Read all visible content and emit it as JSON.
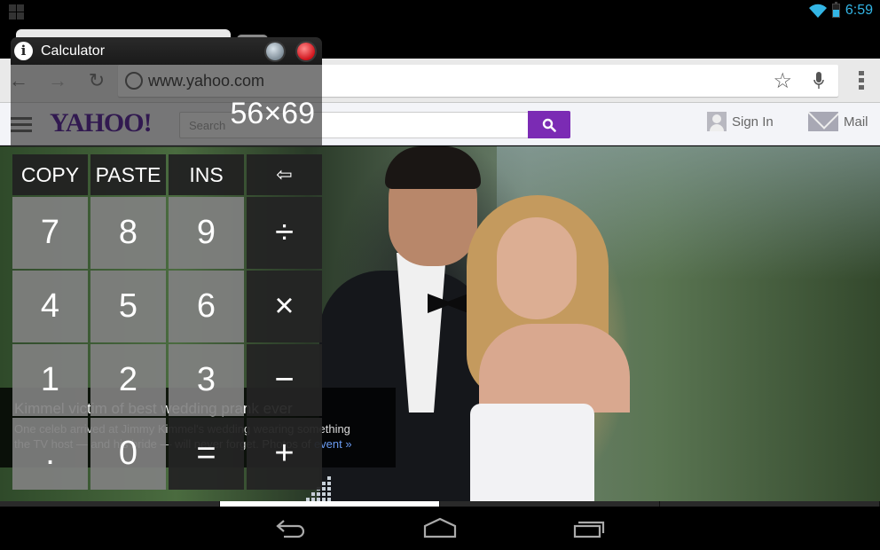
{
  "status_bar": {
    "time": "6:59",
    "app_icon": "calculator-icon",
    "wifi_icon": "wifi-icon",
    "battery_icon": "battery-icon",
    "accent_color": "#33b5e5"
  },
  "browser": {
    "url": "www.yahoo.com",
    "back_icon": "←",
    "forward_icon": "→",
    "reload_icon": "↻",
    "star_icon": "☆"
  },
  "yahoo": {
    "logo": "YAHOO!",
    "search_placeholder": "Search",
    "sign_in": "Sign In",
    "mail": "Mail",
    "brand_color": "#7b2bb4"
  },
  "hero": {
    "headline": "Kimmel victim of best wedding prank ever",
    "body_line1": "One celeb arrived at Jimmy Kimmel's wedding wearing something",
    "body_line2": "the TV host — and his bride — will never forget. Photos of",
    "link": "event »",
    "carousel_total": 4,
    "carousel_active": 1
  },
  "calculator": {
    "title": "Calculator",
    "display": "56×69",
    "info_icon": "i",
    "keys": [
      {
        "label": "COPY",
        "type": "small"
      },
      {
        "label": "PASTE",
        "type": "small"
      },
      {
        "label": "INS",
        "type": "small"
      },
      {
        "label": "⇦",
        "type": "small"
      },
      {
        "label": "7",
        "type": "digit"
      },
      {
        "label": "8",
        "type": "digit"
      },
      {
        "label": "9",
        "type": "digit"
      },
      {
        "label": "÷",
        "type": "op"
      },
      {
        "label": "4",
        "type": "digit"
      },
      {
        "label": "5",
        "type": "digit"
      },
      {
        "label": "6",
        "type": "digit"
      },
      {
        "label": "×",
        "type": "op"
      },
      {
        "label": "1",
        "type": "digit"
      },
      {
        "label": "2",
        "type": "digit"
      },
      {
        "label": "3",
        "type": "digit"
      },
      {
        "label": "−",
        "type": "op"
      },
      {
        "label": ".",
        "type": "digit"
      },
      {
        "label": "0",
        "type": "digit"
      },
      {
        "label": "=",
        "type": "op"
      },
      {
        "label": "+",
        "type": "op"
      }
    ]
  },
  "nav_bar": {
    "back": "back-icon",
    "home": "home-icon",
    "recents": "recents-icon"
  }
}
